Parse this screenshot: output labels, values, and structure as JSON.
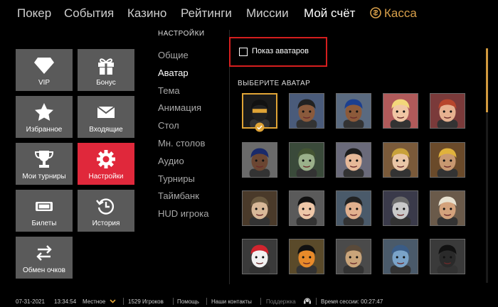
{
  "nav": {
    "poker": "Покер",
    "events": "События",
    "casino": "Казино",
    "ratings": "Рейтинги",
    "missions": "Миссии",
    "account": "Мой счёт",
    "cashier": "Касса",
    "cashier_icon": "coin-icon",
    "accent_color": "#d9a04a"
  },
  "tiles": {
    "vip": "VIP",
    "bonus": "Бонус",
    "favorites": "Избранное",
    "inbox": "Входящие",
    "my_tournaments": "Мои турниры",
    "settings": "Настройки",
    "tickets": "Билеты",
    "history": "История",
    "exchange": "Обмен очков",
    "active_color": "#e0283b"
  },
  "menu": {
    "title": "НАСТРОЙКИ",
    "items": [
      "Общие",
      "Аватар",
      "Тема",
      "Анимация",
      "Стол",
      "Мн. столов",
      "Аудио",
      "Турниры",
      "Таймбанк",
      "HUD игрока"
    ],
    "active_index": 1
  },
  "avatar_panel": {
    "show_avatars_label": "Показ аватаров",
    "show_avatars_checked": false,
    "choose_title": "ВЫБЕРИТЕ АВАТАР",
    "selected_index": 0,
    "avatars": [
      "ninja-avatar",
      "boxer-avatar",
      "baseball-player-avatar",
      "blonde-woman-avatar",
      "redhead-woman-avatar",
      "bandana-man-avatar",
      "zombie-avatar",
      "glasses-woman-avatar",
      "queen-avatar",
      "king-avatar",
      "old-man-avatar",
      "spy-woman-avatar",
      "businessman-avatar",
      "robot-avatar",
      "cowboy-avatar",
      "clown-avatar",
      "tiger-avatar",
      "bulldog-avatar",
      "shark-avatar",
      "bull-avatar"
    ]
  },
  "status": {
    "date": "07-31-2021",
    "time": "13:34:54",
    "timezone": "Местное",
    "players": "1529 Игроков",
    "help": "Помощь",
    "contacts": "Наши контакты",
    "support": "Поддержка",
    "session": "Время сессии: 00:27:47"
  }
}
